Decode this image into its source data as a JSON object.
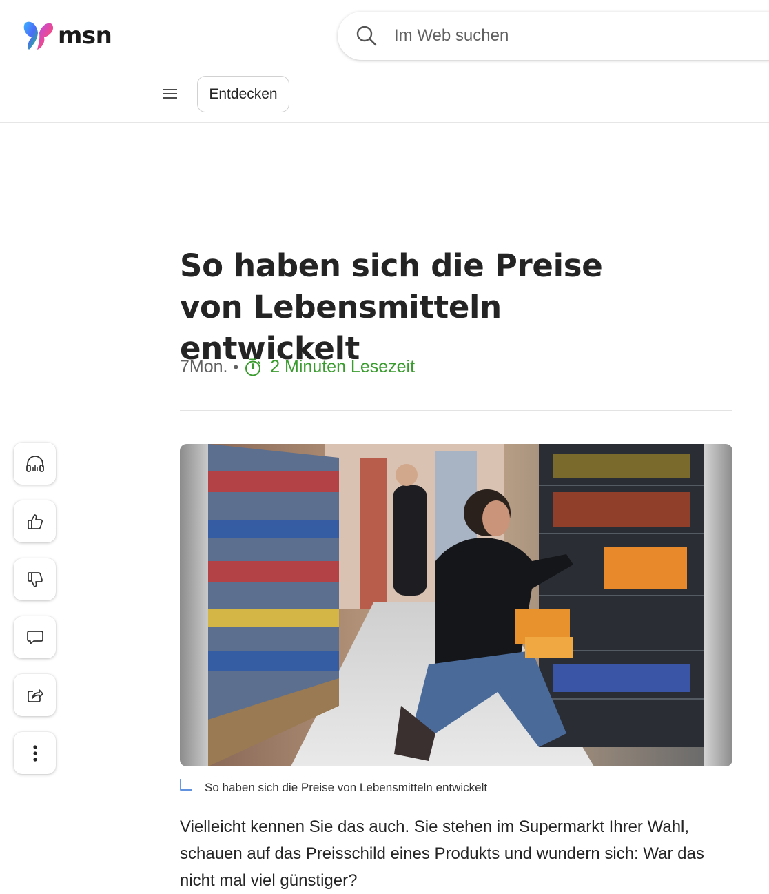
{
  "header": {
    "brand": "msn",
    "search_placeholder": "Im Web suchen",
    "menu_icon": "hamburger-icon",
    "discover_label": "Entdecken"
  },
  "article": {
    "title": "So haben sich die Preise von Lebensmitteln entwickelt",
    "age": "7Mon.",
    "separator": "•",
    "reading_time": "2 Minuten Lesezeit",
    "image_caption": "So haben sich die Preise von Lebensmitteln entwickelt",
    "intro": "Vielleicht kennen Sie das auch. Sie stehen im Supermarkt Ihrer Wahl, schauen auf das Preisschild eines Produkts und wundern sich: War das nicht mal viel günstiger?"
  },
  "side_actions": [
    {
      "name": "listen-button",
      "icon": "headphones-icon"
    },
    {
      "name": "like-button",
      "icon": "thumbs-up-icon"
    },
    {
      "name": "dislike-button",
      "icon": "thumbs-down-icon"
    },
    {
      "name": "comment-button",
      "icon": "comment-icon"
    },
    {
      "name": "share-button",
      "icon": "share-icon"
    },
    {
      "name": "more-options-button",
      "icon": "more-vertical-icon"
    }
  ],
  "colors": {
    "accent_green": "#3a9c2e",
    "text": "#242424",
    "muted": "#616161"
  }
}
